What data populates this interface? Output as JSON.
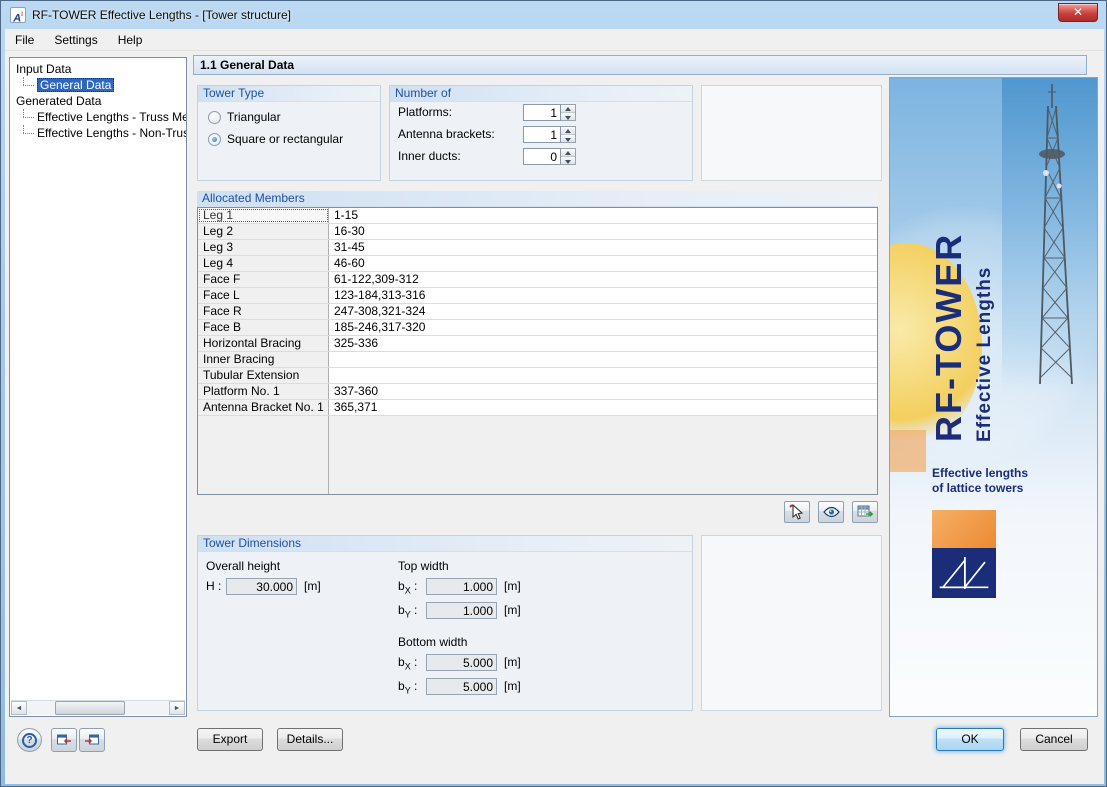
{
  "window": {
    "title": "RF-TOWER Effective Lengths - [Tower structure]",
    "close_glyph": "✕",
    "icon_letter": "A"
  },
  "menubar": {
    "items": [
      {
        "label": "File"
      },
      {
        "label": "Settings"
      },
      {
        "label": "Help"
      }
    ]
  },
  "tree": {
    "items": [
      {
        "label": "Input Data"
      },
      {
        "label": "General Data"
      },
      {
        "label": "Generated Data"
      },
      {
        "label": "Effective Lengths - Truss Memb"
      },
      {
        "label": "Effective Lengths - Non-Truss M"
      }
    ]
  },
  "section": {
    "title": "1.1 General Data"
  },
  "tower_type": {
    "title": "Tower Type",
    "options": [
      {
        "label": "Triangular"
      },
      {
        "label": "Square or rectangular"
      }
    ]
  },
  "number_of": {
    "title": "Number of",
    "fields": [
      {
        "label": "Platforms:",
        "value": "1"
      },
      {
        "label": "Antenna brackets:",
        "value": "1"
      },
      {
        "label": "Inner ducts:",
        "value": "0"
      }
    ]
  },
  "allocated_members": {
    "title": "Allocated Members",
    "rows": [
      {
        "label": "Leg 1",
        "value": "1-15"
      },
      {
        "label": "Leg 2",
        "value": "16-30"
      },
      {
        "label": "Leg 3",
        "value": "31-45"
      },
      {
        "label": "Leg 4",
        "value": "46-60"
      },
      {
        "label": "Face F",
        "value": "61-122,309-312"
      },
      {
        "label": "Face L",
        "value": "123-184,313-316"
      },
      {
        "label": "Face R",
        "value": "247-308,321-324"
      },
      {
        "label": "Face B",
        "value": "185-246,317-320"
      },
      {
        "label": "Horizontal Bracing",
        "value": "325-336"
      },
      {
        "label": "Inner Bracing",
        "value": ""
      },
      {
        "label": "Tubular Extension",
        "value": ""
      },
      {
        "label": "Platform No. 1",
        "value": "337-360"
      },
      {
        "label": "Antenna Bracket No. 1",
        "value": "365,371"
      }
    ]
  },
  "tower_dimensions": {
    "title": "Tower Dimensions",
    "overall_height_label": "Overall height",
    "top_width_label": "Top width",
    "bottom_width_label": "Bottom width",
    "h": {
      "sym": "H",
      "sub": "",
      "suffix": " :",
      "value": "30.000",
      "unit": "[m]"
    },
    "top": [
      {
        "sym": "b",
        "sub": "X",
        "suffix": " :",
        "value": "1.000",
        "unit": "[m]"
      },
      {
        "sym": "b",
        "sub": "Y",
        "suffix": " :",
        "value": "1.000",
        "unit": "[m]"
      }
    ],
    "bottom": [
      {
        "sym": "b",
        "sub": "X",
        "suffix": " :",
        "value": "5.000",
        "unit": "[m]"
      },
      {
        "sym": "b",
        "sub": "Y",
        "suffix": " :",
        "value": "5.000",
        "unit": "[m]"
      }
    ]
  },
  "brand": {
    "title": "RF-TOWER",
    "subtitle": "Effective Lengths",
    "caption_line1": "Effective lengths",
    "caption_line2": "of lattice towers"
  },
  "footer": {
    "help_glyph": "?",
    "export_label": "Export",
    "details_label": "Details...",
    "ok_label": "OK",
    "cancel_label": "Cancel"
  },
  "colors": {
    "titlebar_blue": "#aacdec",
    "group_title_blue": "#1e50a0",
    "selection_blue": "#2e66c0",
    "brand_navy": "#1b2d78",
    "brand_orange": "#ec8a33",
    "close_red": "#c33d3a",
    "ok_glow_blue": "#7fc0ec"
  }
}
